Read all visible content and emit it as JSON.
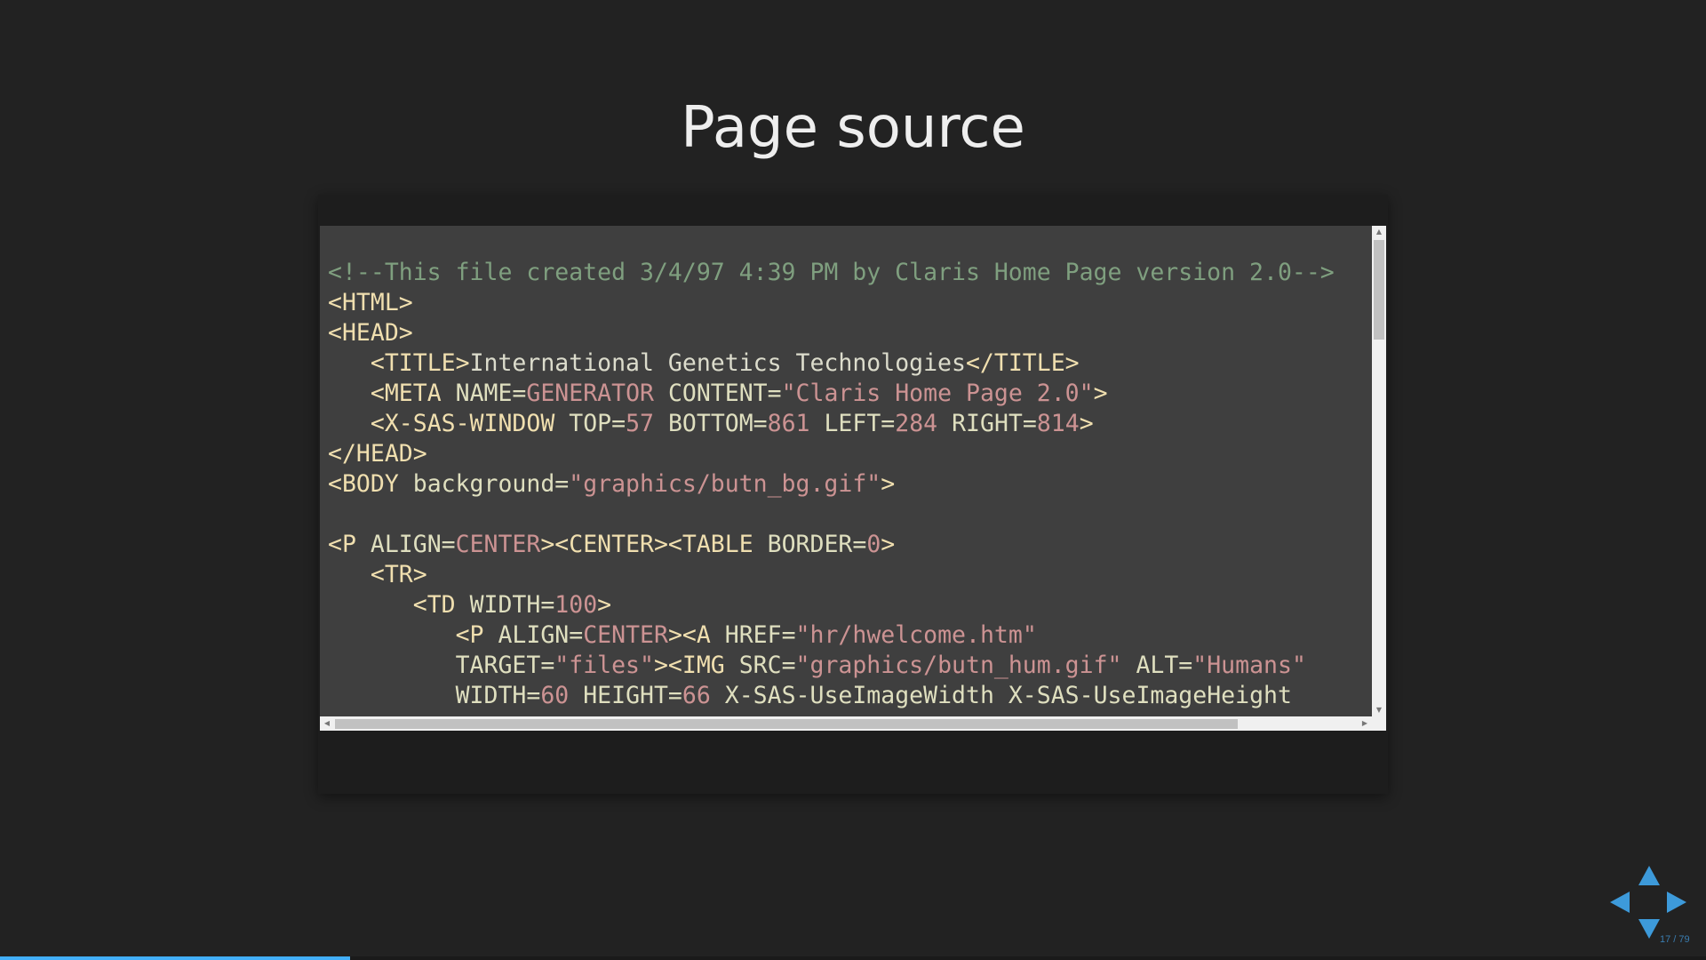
{
  "slide": {
    "title": "Page source"
  },
  "code": {
    "lines": [
      [
        [
          "c-comment",
          "<!--This file created 3/4/97 4:39 PM by Claris Home Page version 2.0-->"
        ]
      ],
      [
        [
          "c-tag",
          "<HTML>"
        ]
      ],
      [
        [
          "c-tag",
          "<HEAD>"
        ]
      ],
      [
        [
          "c-text",
          "   "
        ],
        [
          "c-tag",
          "<TITLE>"
        ],
        [
          "c-text",
          "International Genetics Technologies"
        ],
        [
          "c-tag",
          "</TITLE>"
        ]
      ],
      [
        [
          "c-text",
          "   "
        ],
        [
          "c-tag",
          "<META"
        ],
        [
          "c-attr",
          " NAME="
        ],
        [
          "c-str",
          "GENERATOR"
        ],
        [
          "c-attr",
          " CONTENT="
        ],
        [
          "c-str",
          "\"Claris Home Page 2.0\""
        ],
        [
          "c-tag",
          ">"
        ]
      ],
      [
        [
          "c-text",
          "   "
        ],
        [
          "c-tag",
          "<X-SAS-WINDOW"
        ],
        [
          "c-attr",
          " TOP="
        ],
        [
          "c-num",
          "57"
        ],
        [
          "c-attr",
          " BOTTOM="
        ],
        [
          "c-num",
          "861"
        ],
        [
          "c-attr",
          " LEFT="
        ],
        [
          "c-num",
          "284"
        ],
        [
          "c-attr",
          " RIGHT="
        ],
        [
          "c-num",
          "814"
        ],
        [
          "c-tag",
          ">"
        ]
      ],
      [
        [
          "c-tag",
          "</HEAD>"
        ]
      ],
      [
        [
          "c-tag",
          "<BODY"
        ],
        [
          "c-attr",
          " background="
        ],
        [
          "c-str",
          "\"graphics/butn_bg.gif\""
        ],
        [
          "c-tag",
          ">"
        ]
      ],
      [
        [
          "c-text",
          ""
        ]
      ],
      [
        [
          "c-tag",
          "<P"
        ],
        [
          "c-attr",
          " ALIGN="
        ],
        [
          "c-str",
          "CENTER"
        ],
        [
          "c-tag",
          "><CENTER><TABLE"
        ],
        [
          "c-attr",
          " BORDER="
        ],
        [
          "c-num",
          "0"
        ],
        [
          "c-tag",
          ">"
        ]
      ],
      [
        [
          "c-text",
          "   "
        ],
        [
          "c-tag",
          "<TR>"
        ]
      ],
      [
        [
          "c-text",
          "      "
        ],
        [
          "c-tag",
          "<TD"
        ],
        [
          "c-attr",
          " WIDTH="
        ],
        [
          "c-num",
          "100"
        ],
        [
          "c-tag",
          ">"
        ]
      ],
      [
        [
          "c-text",
          "         "
        ],
        [
          "c-tag",
          "<P"
        ],
        [
          "c-attr",
          " ALIGN="
        ],
        [
          "c-str",
          "CENTER"
        ],
        [
          "c-tag",
          "><A"
        ],
        [
          "c-attr",
          " HREF="
        ],
        [
          "c-str",
          "\"hr/hwelcome.htm\""
        ]
      ],
      [
        [
          "c-text",
          "         "
        ],
        [
          "c-attr",
          "TARGET="
        ],
        [
          "c-str",
          "\"files\""
        ],
        [
          "c-tag",
          "><IMG"
        ],
        [
          "c-attr",
          " SRC="
        ],
        [
          "c-str",
          "\"graphics/butn_hum.gif\""
        ],
        [
          "c-attr",
          " ALT="
        ],
        [
          "c-str",
          "\"Humans\""
        ]
      ],
      [
        [
          "c-text",
          "         "
        ],
        [
          "c-attr",
          "WIDTH="
        ],
        [
          "c-num",
          "60"
        ],
        [
          "c-attr",
          " HEIGHT="
        ],
        [
          "c-num",
          "66"
        ],
        [
          "c-attr",
          " X-SAS-UseImageWidth X-SAS-UseImageHeight"
        ]
      ]
    ]
  },
  "navigation": {
    "slide_number": "17 / 79",
    "progress": 0.205
  },
  "colors": {
    "background": "#222222",
    "code_background": "#3f3f3f",
    "accent": "#42affa"
  }
}
